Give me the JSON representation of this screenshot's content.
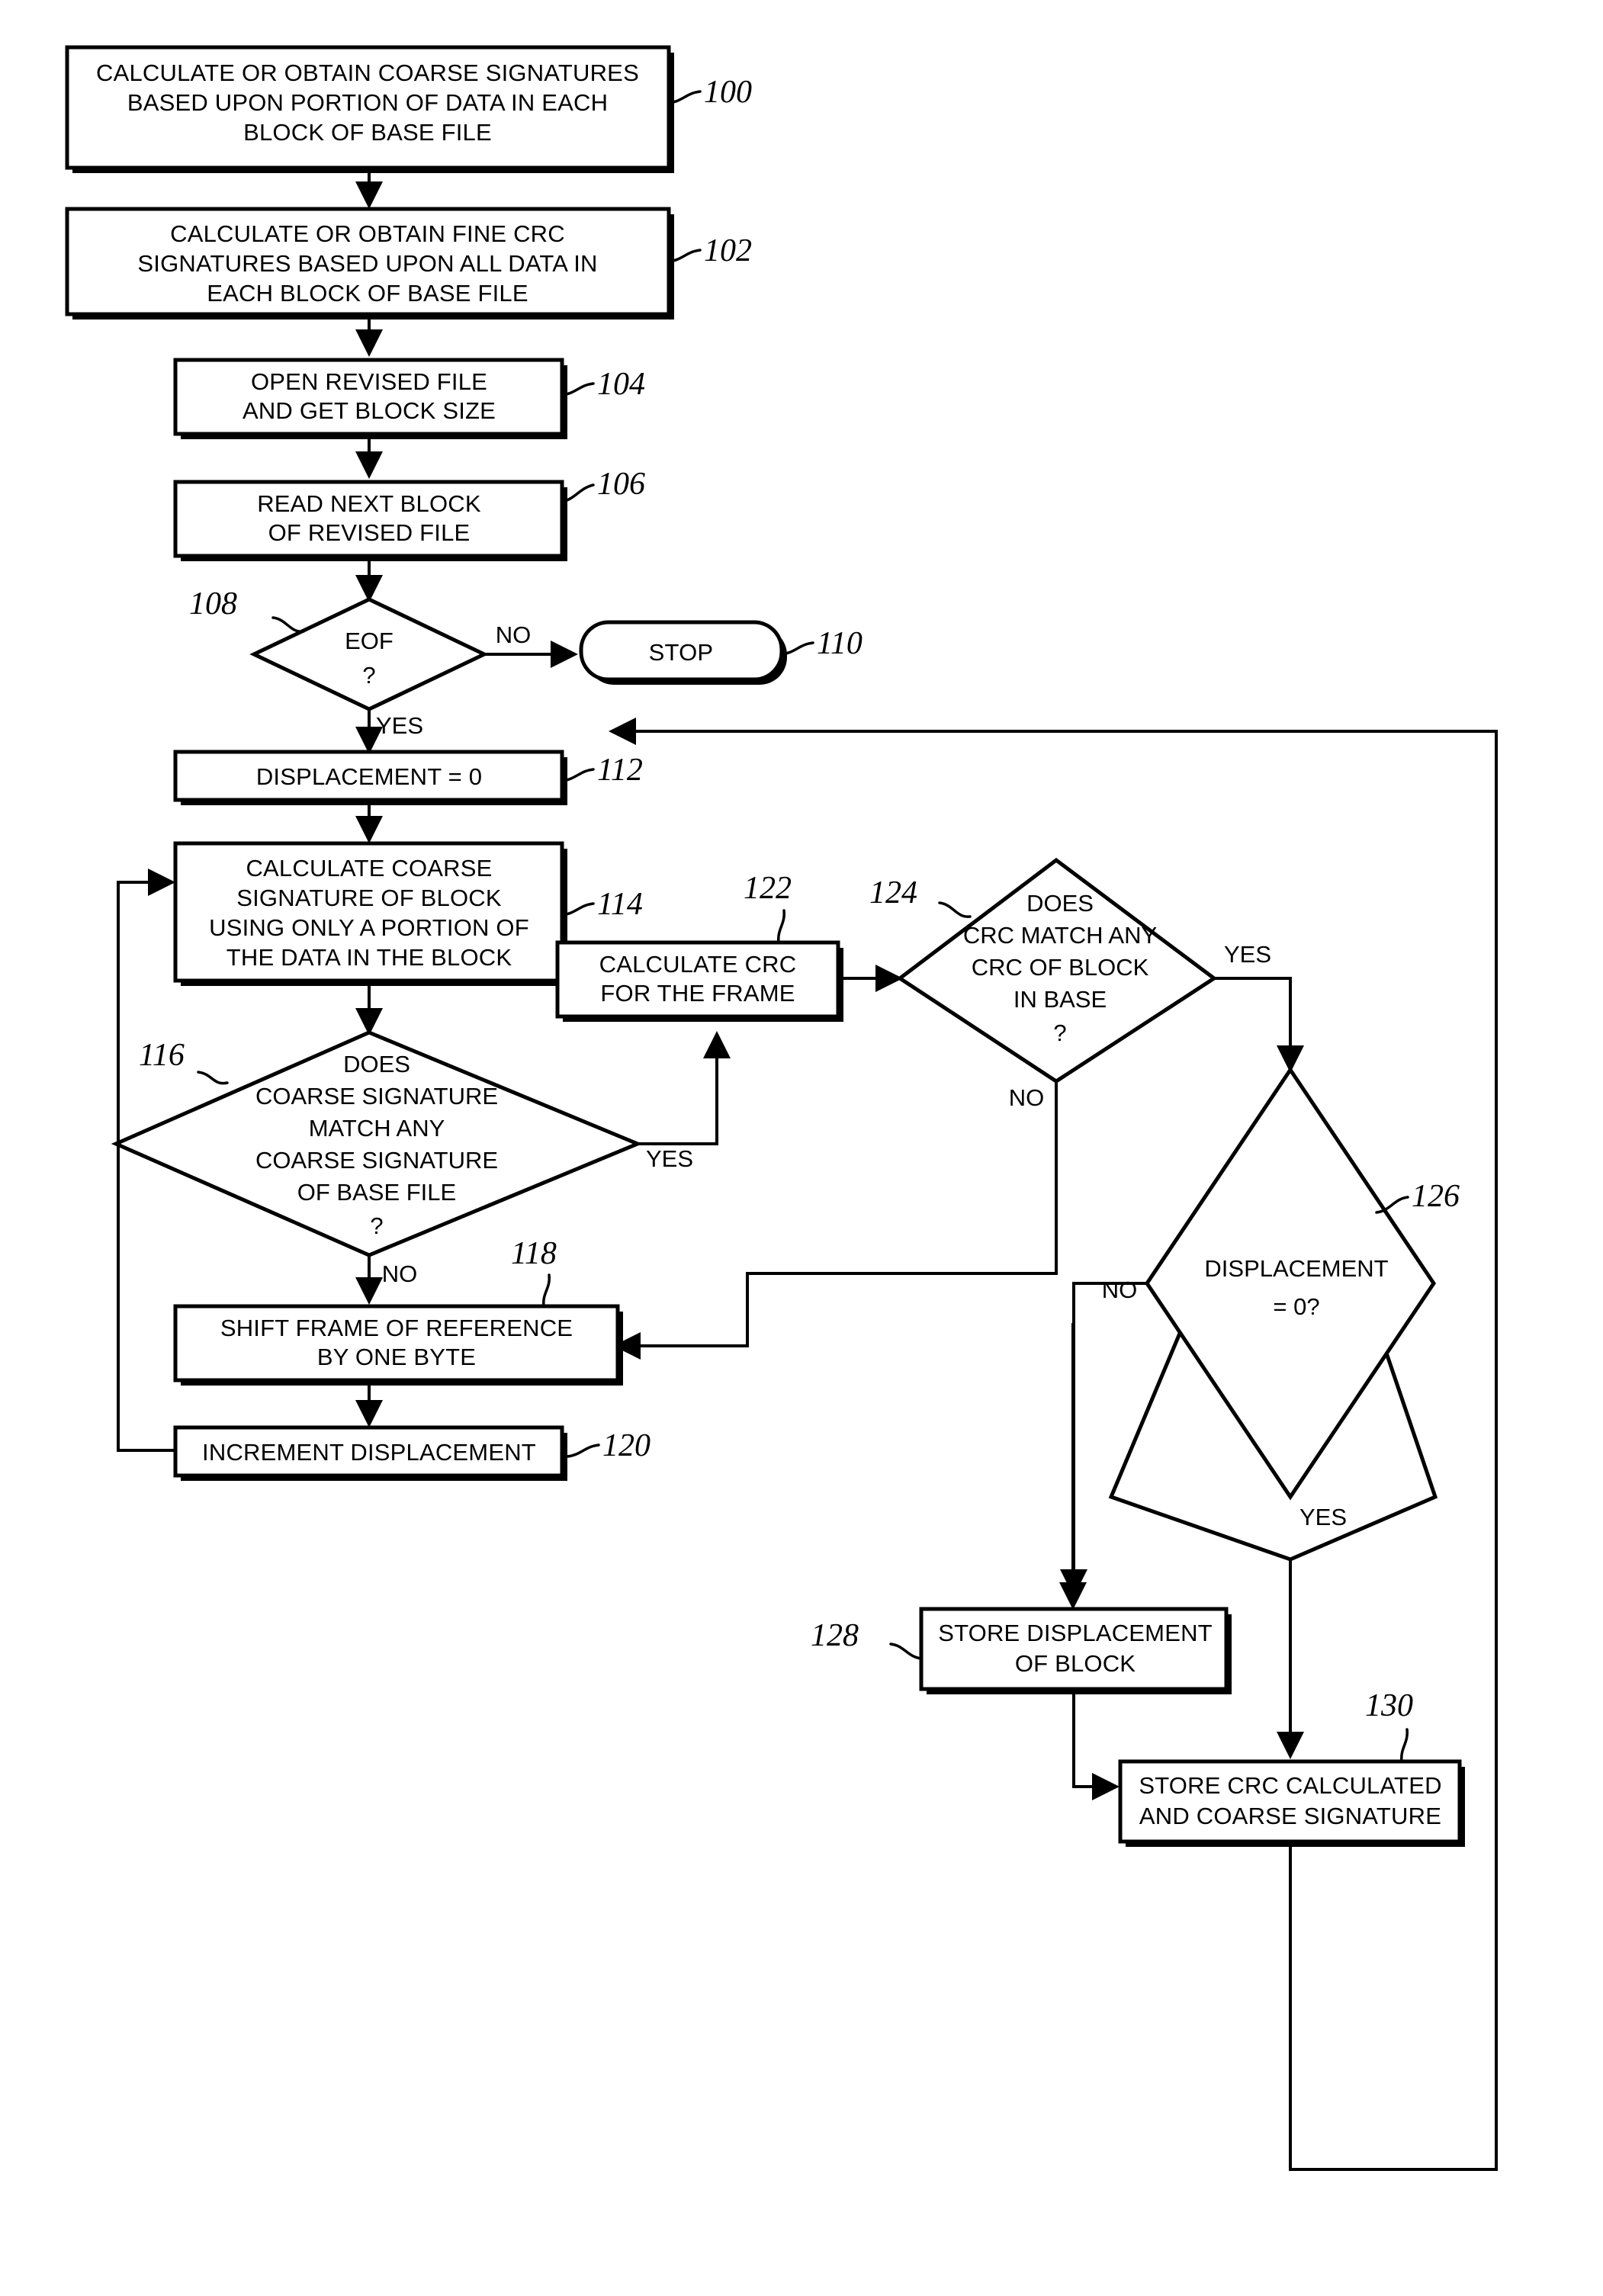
{
  "diagram": {
    "type": "flowchart",
    "title": "File differencing using coarse signatures and fine CRC signatures",
    "nodes": [
      {
        "id": "100",
        "shape": "process",
        "ref": "100",
        "lines": [
          "CALCULATE OR OBTAIN COARSE SIGNATURES",
          "BASED UPON PORTION OF DATA IN EACH",
          "BLOCK OF BASE FILE"
        ]
      },
      {
        "id": "102",
        "shape": "process",
        "ref": "102",
        "lines": [
          "CALCULATE OR OBTAIN FINE CRC",
          "SIGNATURES BASED UPON ALL DATA IN",
          "EACH BLOCK OF BASE FILE"
        ]
      },
      {
        "id": "104",
        "shape": "process",
        "ref": "104",
        "lines": [
          "OPEN REVISED FILE",
          "AND GET BLOCK SIZE"
        ]
      },
      {
        "id": "106",
        "shape": "process",
        "ref": "106",
        "lines": [
          "READ NEXT BLOCK",
          "OF REVISED FILE"
        ]
      },
      {
        "id": "108",
        "shape": "decision",
        "ref": "108",
        "lines": [
          "EOF",
          "?"
        ]
      },
      {
        "id": "110",
        "shape": "terminator",
        "ref": "110",
        "lines": [
          "STOP"
        ]
      },
      {
        "id": "112",
        "shape": "process",
        "ref": "112",
        "lines": [
          "DISPLACEMENT = 0"
        ]
      },
      {
        "id": "114",
        "shape": "process",
        "ref": "114",
        "lines": [
          "CALCULATE COARSE",
          "SIGNATURE OF BLOCK",
          "USING ONLY A PORTION OF",
          "THE DATA IN THE BLOCK"
        ]
      },
      {
        "id": "116",
        "shape": "decision",
        "ref": "116",
        "lines": [
          "DOES",
          "COARSE SIGNATURE",
          "MATCH ANY",
          "COARSE SIGNATURE",
          "OF BASE FILE",
          "?"
        ]
      },
      {
        "id": "118",
        "shape": "process",
        "ref": "118",
        "lines": [
          "SHIFT FRAME OF REFERENCE",
          "BY ONE BYTE"
        ]
      },
      {
        "id": "120",
        "shape": "process",
        "ref": "120",
        "lines": [
          "INCREMENT DISPLACEMENT"
        ]
      },
      {
        "id": "122",
        "shape": "process",
        "ref": "122",
        "lines": [
          "CALCULATE CRC",
          "FOR THE FRAME"
        ]
      },
      {
        "id": "124",
        "shape": "decision",
        "ref": "124",
        "lines": [
          "DOES",
          "CRC MATCH ANY",
          "CRC OF BLOCK",
          "IN BASE",
          "?"
        ]
      },
      {
        "id": "126",
        "shape": "decision",
        "ref": "126",
        "lines": [
          "DISPLACEMENT",
          "= 0?"
        ]
      },
      {
        "id": "128",
        "shape": "process",
        "ref": "128",
        "lines": [
          "STORE DISPLACEMENT",
          "OF BLOCK"
        ]
      },
      {
        "id": "130",
        "shape": "process",
        "ref": "130",
        "lines": [
          "STORE CRC CALCULATED",
          "AND COARSE SIGNATURE"
        ]
      }
    ],
    "edge_labels": [
      {
        "id": "108-no",
        "text": "NO"
      },
      {
        "id": "108-yes",
        "text": "YES"
      },
      {
        "id": "116-yes",
        "text": "YES"
      },
      {
        "id": "116-no",
        "text": "NO"
      },
      {
        "id": "124-yes",
        "text": "YES"
      },
      {
        "id": "124-no",
        "text": "NO"
      },
      {
        "id": "126-no",
        "text": "NO"
      },
      {
        "id": "126-yes",
        "text": "YES"
      }
    ],
    "colors": {
      "stroke": "#000000",
      "fill": "#ffffff",
      "background": "#ffffff"
    }
  }
}
